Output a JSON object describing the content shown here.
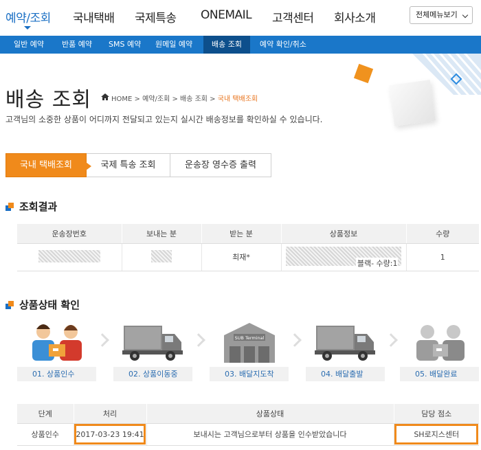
{
  "topnav": {
    "items": [
      "예약/조회",
      "국내택배",
      "국제특송",
      "ONEMAIL",
      "고객센터",
      "회사소개"
    ],
    "all_menu": "전체메뉴보기"
  },
  "subnav": {
    "items": [
      "일반 예약",
      "반품 예약",
      "SMS 예약",
      "원메일 예약",
      "배송 조회",
      "예약 확인/취소"
    ]
  },
  "header": {
    "title": "배송 조회",
    "breadcrumb": [
      "HOME",
      "예약/조회",
      "배송 조회",
      "국내 택배조회"
    ],
    "description": "고객님의 소중한 상품이 어디까지 전달되고 있는지 실시간 배송정보를 확인하실 수 있습니다."
  },
  "tabs": [
    "국내 택배조회",
    "국제 특송 조회",
    "운송장 영수증 출력"
  ],
  "result": {
    "title": "조회결과",
    "columns": [
      "운송장번호",
      "보내는 분",
      "받는 분",
      "상품정보",
      "수량"
    ],
    "row": {
      "receiver": "최재*",
      "product_suffix": "블랙- 수량:1",
      "quantity": "1"
    }
  },
  "status": {
    "title": "상품상태 확인",
    "steps": [
      "01. 상품인수",
      "02. 상품이동중",
      "03. 배달지도착",
      "04. 배달출발",
      "05. 배달완료"
    ],
    "terminal_sign": "SUB Terminal",
    "columns": [
      "단계",
      "처리",
      "상품상태",
      "담당 점소"
    ],
    "rows": [
      {
        "stage": "상품인수",
        "time": "2017-03-23 19:41",
        "state": "보내시는 고객님으로부터 상품을 인수받았습니다",
        "office": "SH로지스센터"
      }
    ]
  },
  "colors": {
    "brand_blue": "#1a77c9",
    "accent_orange": "#f08a1b"
  }
}
